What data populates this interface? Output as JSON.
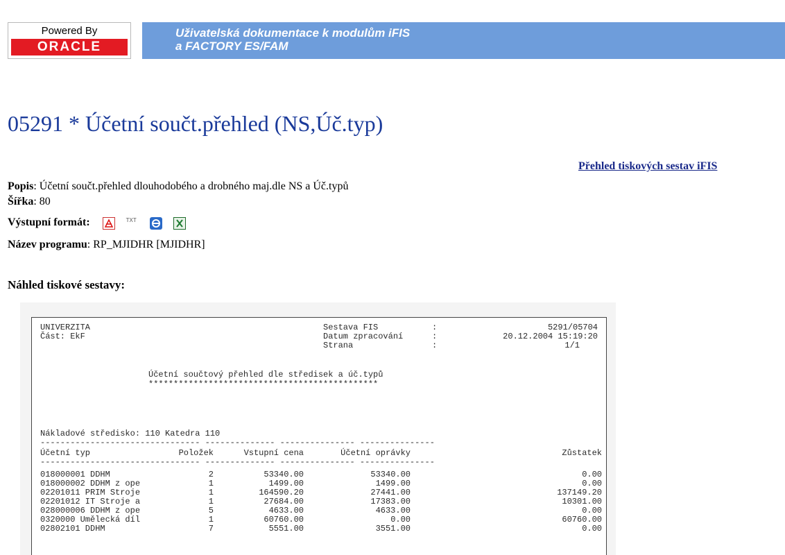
{
  "header": {
    "powered_by": "Powered By",
    "oracle": "ORACLE",
    "title": "Uživatelská dokumentace k modulům iFIS\na FACTORY ES/FAM"
  },
  "page": {
    "title": "05291 * Účetní součt.přehled (NS,Úč.typ)",
    "link_label": "Přehled tiskových sestav iFIS",
    "popis_label": "Popis",
    "popis_value": "Účetní součt.přehled dlouhodobého a drobného maj.dle NS a Úč.typů",
    "sirka_label": "Šířka",
    "sirka_value": "80",
    "format_label": "Výstupní formát:",
    "format_icons": [
      "pdf-icon",
      "txt-icon",
      "html-icon",
      "excel-icon"
    ],
    "txt_icon_text": "TXT",
    "program_label": "Název programu",
    "program_value": "RP_MJIDHR [MJIDHR]",
    "preview_heading": "Náhled tiskové sestavy:"
  },
  "report": {
    "org": "UNIVERZITA",
    "part": "Část: EkF",
    "sestava_label": "Sestava FIS",
    "sestava_value": "5291/05704",
    "datum_label": "Datum zpracování",
    "datum_value": "20.12.2004 15:19:20",
    "strana_label": "Strana",
    "strana_value": "1/1",
    "colon": ":",
    "report_title": "Účetní součtový přehled dle středisek a úč.typů",
    "stars": "**********************************************",
    "cost_center": "Nákladové středisko: 110 Katedra 110",
    "columns": [
      "Účetní typ",
      "Položek",
      "Vstupní cena",
      "Účetní oprávky",
      "Zůstatek"
    ],
    "dash_line": "-------------------------------- -------------- --------------- ---------------",
    "rows": [
      [
        "018000001 DDHM",
        "2",
        "53340.00",
        "53340.00",
        "0.00"
      ],
      [
        "018000002 DDHM z ope",
        "1",
        "1499.00",
        "1499.00",
        "0.00"
      ],
      [
        "02201011 PRIM Stroje",
        "1",
        "164590.20",
        "27441.00",
        "137149.20"
      ],
      [
        "02201012 IT Stroje a",
        "1",
        "27684.00",
        "17383.00",
        "10301.00"
      ],
      [
        "028000006 DDHM z ope",
        "5",
        "4633.00",
        "4633.00",
        "0.00"
      ],
      [
        "0320000 Umělecká díl",
        "1",
        "60760.00",
        "0.00",
        "60760.00"
      ],
      [
        "02802101 DDHM",
        "7",
        "5551.00",
        "3551.00",
        "0.00"
      ]
    ]
  },
  "colors": {
    "header_bar": "#6e9ddb",
    "oracle_red": "#e31b23",
    "title_blue": "#1a3a9a"
  }
}
